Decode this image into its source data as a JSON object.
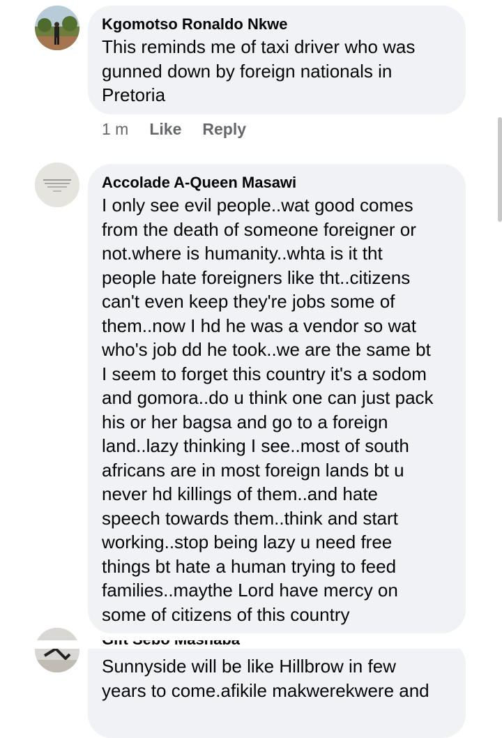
{
  "comments": [
    {
      "author": "Kgomotso Ronaldo Nkwe",
      "text": "This reminds me of taxi driver who was\ngunned down by foreign nationals in\nPretoria",
      "time": "1 m",
      "like": "Like",
      "reply": "Reply"
    },
    {
      "author": "Accolade A-Queen Masawi",
      "text": "I only see evil people..wat good comes\nfrom the death of someone foreigner or\nnot.where is humanity..whta is it tht\npeople hate foreigners like tht..citizens\ncan't even keep they're jobs some of\nthem..now I hd he was a vendor so wat\nwho's job dd he took..we are the same bt\nI seem to forget this country it's a sodom\nand gomora..do u think one can just pack\nhis or her bagsa and go to a foreign\nland..lazy thinking I see..most of south\nafricans are in most foreign lands bt u\nnever hd killings of them..and hate\nspeech towards them..think and start\nworking..stop being lazy u need free\nthings  bt hate a human trying to feed\nfamilies..maythe Lord have mercy on\nsome of citizens of this country"
    },
    {
      "author": "Gift Sebo Mashaba",
      "text": "Sunnyside will be like Hillbrow in few\nyears to come.afikile makwerekwere and"
    }
  ],
  "colors": {
    "bubble": "#f0f2f5",
    "text": "#050505",
    "meta": "#65676b"
  }
}
